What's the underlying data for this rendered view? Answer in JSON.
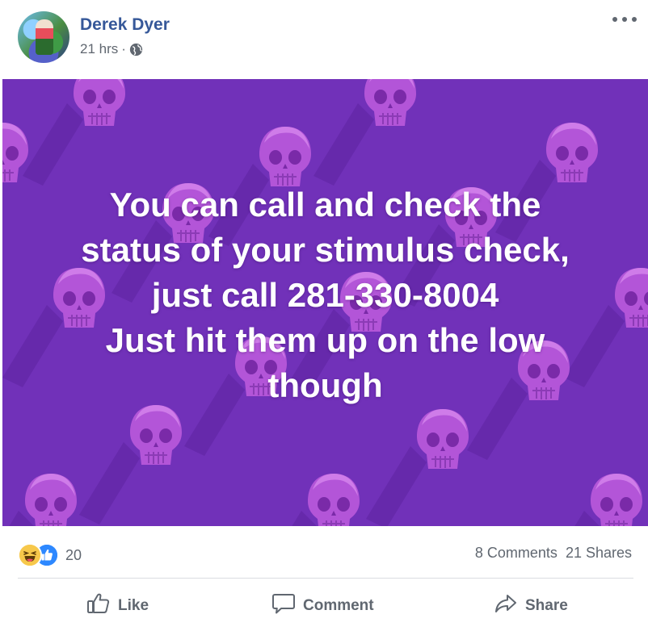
{
  "post": {
    "author": "Derek Dyer",
    "time": "21 hrs",
    "separator": "·",
    "privacy_icon": "globe-icon",
    "menu_icon": "more-options-icon"
  },
  "image": {
    "background_color": "#7131b9",
    "pattern": "skull-pattern",
    "text_lines": [
      "You can call and check the",
      "status of your stimulus check,",
      "just call 281-330-8004",
      "Just hit them up on the low",
      "though"
    ]
  },
  "stats": {
    "reaction_icons": [
      "haha-reaction-icon",
      "like-reaction-icon"
    ],
    "reaction_count": "20",
    "comments": "8 Comments",
    "shares": "21 Shares"
  },
  "actions": {
    "like": "Like",
    "comment": "Comment",
    "share": "Share"
  },
  "colors": {
    "name_link": "#365899",
    "meta_text": "#606770",
    "like_blue": "#2d88ff",
    "haha_yellow": "#f7c84b"
  }
}
